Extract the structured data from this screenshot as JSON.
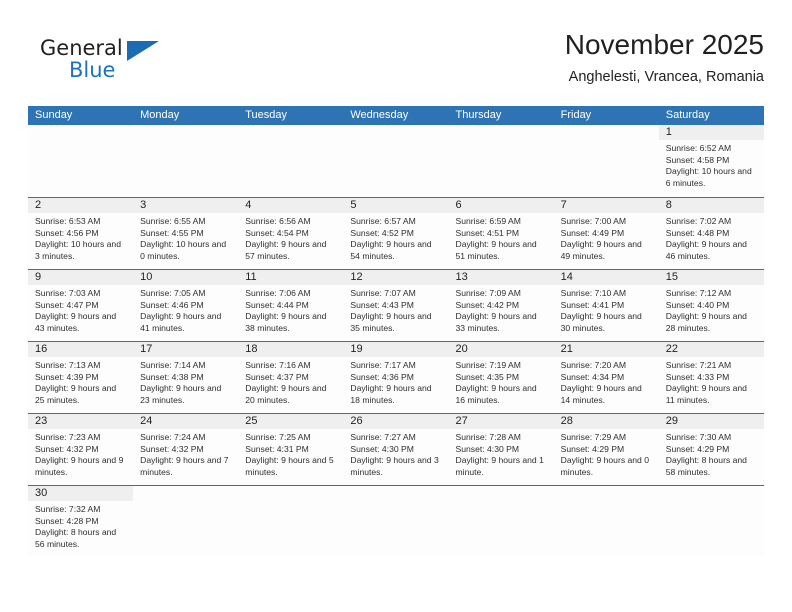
{
  "logo": {
    "word1": "General",
    "word2": "Blue",
    "triangle_color": "#1c6cb3",
    "word2_color": "#1c75bc"
  },
  "header": {
    "title": "November 2025",
    "subtitle": "Anghelesti, Vrancea, Romania"
  },
  "theme": {
    "header_blue": "#2e74b5",
    "daynum_band": "#efefef",
    "text": "#231f20"
  },
  "weekdays": [
    "Sunday",
    "Monday",
    "Tuesday",
    "Wednesday",
    "Thursday",
    "Friday",
    "Saturday"
  ],
  "labels": {
    "sunrise": "Sunrise:",
    "sunset": "Sunset:",
    "daylight": "Daylight:"
  },
  "weeks": [
    [
      {
        "empty": true
      },
      {
        "empty": true
      },
      {
        "empty": true
      },
      {
        "empty": true
      },
      {
        "empty": true
      },
      {
        "empty": true
      },
      {
        "day": "1",
        "sunrise": "Sunrise: 6:52 AM",
        "sunset": "Sunset: 4:58 PM",
        "daylight": "Daylight: 10 hours and 6 minutes."
      }
    ],
    [
      {
        "day": "2",
        "sunrise": "Sunrise: 6:53 AM",
        "sunset": "Sunset: 4:56 PM",
        "daylight": "Daylight: 10 hours and 3 minutes."
      },
      {
        "day": "3",
        "sunrise": "Sunrise: 6:55 AM",
        "sunset": "Sunset: 4:55 PM",
        "daylight": "Daylight: 10 hours and 0 minutes."
      },
      {
        "day": "4",
        "sunrise": "Sunrise: 6:56 AM",
        "sunset": "Sunset: 4:54 PM",
        "daylight": "Daylight: 9 hours and 57 minutes."
      },
      {
        "day": "5",
        "sunrise": "Sunrise: 6:57 AM",
        "sunset": "Sunset: 4:52 PM",
        "daylight": "Daylight: 9 hours and 54 minutes."
      },
      {
        "day": "6",
        "sunrise": "Sunrise: 6:59 AM",
        "sunset": "Sunset: 4:51 PM",
        "daylight": "Daylight: 9 hours and 51 minutes."
      },
      {
        "day": "7",
        "sunrise": "Sunrise: 7:00 AM",
        "sunset": "Sunset: 4:49 PM",
        "daylight": "Daylight: 9 hours and 49 minutes."
      },
      {
        "day": "8",
        "sunrise": "Sunrise: 7:02 AM",
        "sunset": "Sunset: 4:48 PM",
        "daylight": "Daylight: 9 hours and 46 minutes."
      }
    ],
    [
      {
        "day": "9",
        "sunrise": "Sunrise: 7:03 AM",
        "sunset": "Sunset: 4:47 PM",
        "daylight": "Daylight: 9 hours and 43 minutes."
      },
      {
        "day": "10",
        "sunrise": "Sunrise: 7:05 AM",
        "sunset": "Sunset: 4:46 PM",
        "daylight": "Daylight: 9 hours and 41 minutes."
      },
      {
        "day": "11",
        "sunrise": "Sunrise: 7:06 AM",
        "sunset": "Sunset: 4:44 PM",
        "daylight": "Daylight: 9 hours and 38 minutes."
      },
      {
        "day": "12",
        "sunrise": "Sunrise: 7:07 AM",
        "sunset": "Sunset: 4:43 PM",
        "daylight": "Daylight: 9 hours and 35 minutes."
      },
      {
        "day": "13",
        "sunrise": "Sunrise: 7:09 AM",
        "sunset": "Sunset: 4:42 PM",
        "daylight": "Daylight: 9 hours and 33 minutes."
      },
      {
        "day": "14",
        "sunrise": "Sunrise: 7:10 AM",
        "sunset": "Sunset: 4:41 PM",
        "daylight": "Daylight: 9 hours and 30 minutes."
      },
      {
        "day": "15",
        "sunrise": "Sunrise: 7:12 AM",
        "sunset": "Sunset: 4:40 PM",
        "daylight": "Daylight: 9 hours and 28 minutes."
      }
    ],
    [
      {
        "day": "16",
        "sunrise": "Sunrise: 7:13 AM",
        "sunset": "Sunset: 4:39 PM",
        "daylight": "Daylight: 9 hours and 25 minutes."
      },
      {
        "day": "17",
        "sunrise": "Sunrise: 7:14 AM",
        "sunset": "Sunset: 4:38 PM",
        "daylight": "Daylight: 9 hours and 23 minutes."
      },
      {
        "day": "18",
        "sunrise": "Sunrise: 7:16 AM",
        "sunset": "Sunset: 4:37 PM",
        "daylight": "Daylight: 9 hours and 20 minutes."
      },
      {
        "day": "19",
        "sunrise": "Sunrise: 7:17 AM",
        "sunset": "Sunset: 4:36 PM",
        "daylight": "Daylight: 9 hours and 18 minutes."
      },
      {
        "day": "20",
        "sunrise": "Sunrise: 7:19 AM",
        "sunset": "Sunset: 4:35 PM",
        "daylight": "Daylight: 9 hours and 16 minutes."
      },
      {
        "day": "21",
        "sunrise": "Sunrise: 7:20 AM",
        "sunset": "Sunset: 4:34 PM",
        "daylight": "Daylight: 9 hours and 14 minutes."
      },
      {
        "day": "22",
        "sunrise": "Sunrise: 7:21 AM",
        "sunset": "Sunset: 4:33 PM",
        "daylight": "Daylight: 9 hours and 11 minutes."
      }
    ],
    [
      {
        "day": "23",
        "sunrise": "Sunrise: 7:23 AM",
        "sunset": "Sunset: 4:32 PM",
        "daylight": "Daylight: 9 hours and 9 minutes."
      },
      {
        "day": "24",
        "sunrise": "Sunrise: 7:24 AM",
        "sunset": "Sunset: 4:32 PM",
        "daylight": "Daylight: 9 hours and 7 minutes."
      },
      {
        "day": "25",
        "sunrise": "Sunrise: 7:25 AM",
        "sunset": "Sunset: 4:31 PM",
        "daylight": "Daylight: 9 hours and 5 minutes."
      },
      {
        "day": "26",
        "sunrise": "Sunrise: 7:27 AM",
        "sunset": "Sunset: 4:30 PM",
        "daylight": "Daylight: 9 hours and 3 minutes."
      },
      {
        "day": "27",
        "sunrise": "Sunrise: 7:28 AM",
        "sunset": "Sunset: 4:30 PM",
        "daylight": "Daylight: 9 hours and 1 minute."
      },
      {
        "day": "28",
        "sunrise": "Sunrise: 7:29 AM",
        "sunset": "Sunset: 4:29 PM",
        "daylight": "Daylight: 9 hours and 0 minutes."
      },
      {
        "day": "29",
        "sunrise": "Sunrise: 7:30 AM",
        "sunset": "Sunset: 4:29 PM",
        "daylight": "Daylight: 8 hours and 58 minutes."
      }
    ],
    [
      {
        "day": "30",
        "sunrise": "Sunrise: 7:32 AM",
        "sunset": "Sunset: 4:28 PM",
        "daylight": "Daylight: 8 hours and 56 minutes."
      },
      {
        "empty": true
      },
      {
        "empty": true
      },
      {
        "empty": true
      },
      {
        "empty": true
      },
      {
        "empty": true
      },
      {
        "empty": true
      }
    ]
  ]
}
